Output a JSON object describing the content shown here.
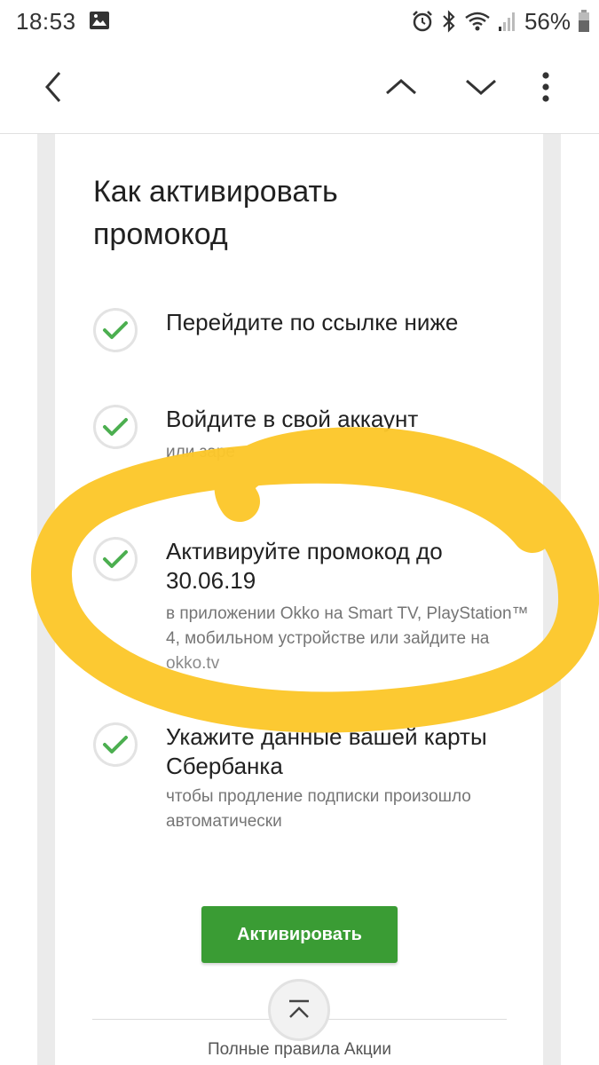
{
  "status_bar": {
    "time": "18:53",
    "battery_percent": "56%",
    "icons": [
      "gallery-icon",
      "alarm-icon",
      "bluetooth-icon",
      "wifi-icon",
      "signal-icon",
      "battery-icon"
    ]
  },
  "toolbar": {
    "icons": [
      "back-arrow-icon",
      "chevron-up-icon",
      "chevron-down-icon",
      "more-vert-icon"
    ]
  },
  "content": {
    "title": "Как активировать промокод",
    "steps": [
      {
        "title": "Перейдите по ссылке ниже",
        "description": ""
      },
      {
        "title": "Войдите в свой аккаунт",
        "description": "или заре"
      },
      {
        "title": "Активируйте промокод до 30.06.19",
        "description": "в приложении Okko на Smart TV, PlayStation™ 4, мобильном устройстве или зайдите на",
        "link": "okko.tv"
      },
      {
        "title": "Укажите данные вашей карты Сбербанка",
        "description": "чтобы продление подписки произошло автоматически"
      }
    ],
    "activate_button": "Активировать",
    "rules_link": "Полные правила Акции"
  },
  "colors": {
    "accent_green": "#3a9c34",
    "check_green": "#4caf50",
    "highlight_yellow": "#fcc72a"
  }
}
